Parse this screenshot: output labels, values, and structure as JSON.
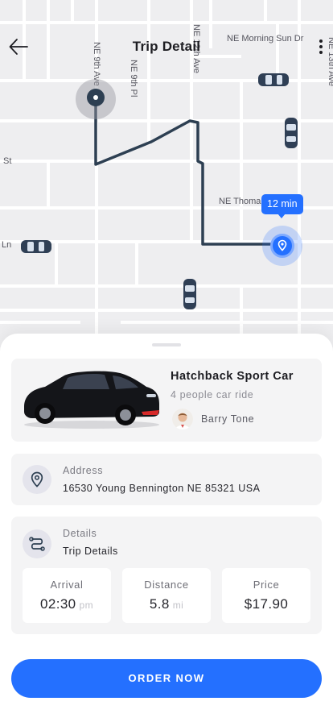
{
  "header": {
    "title": "Trip Detail",
    "back_icon": "arrow-left-icon",
    "menu_icon": "more-vertical-icon"
  },
  "map": {
    "streets": [
      "NE Morning Sun Dr",
      "NE 9th Ave",
      "NE 9th Pl",
      "NE 12th Ave",
      "NE 13th Ave",
      "St",
      "NE Thoma",
      "Ln"
    ],
    "eta_label": "12 min"
  },
  "car": {
    "name": "Hatchback Sport Car",
    "capacity": "4 people car ride",
    "driver_name": "Barry Tone"
  },
  "address": {
    "label": "Address",
    "value": "16530 Young Bennington NE 85321 USA",
    "icon": "location-pin-icon"
  },
  "details": {
    "label": "Details",
    "value": "Trip Details",
    "icon": "route-icon",
    "stats": [
      {
        "label": "Arrival",
        "value": "02:30",
        "unit": "pm"
      },
      {
        "label": "Distance",
        "value": "5.8",
        "unit": "mi"
      },
      {
        "label": "Price",
        "value": "$17.90",
        "unit": ""
      }
    ]
  },
  "order_button": {
    "label": "ORDER NOW"
  },
  "colors": {
    "accent": "#2470ff",
    "route": "#2d3f52"
  }
}
